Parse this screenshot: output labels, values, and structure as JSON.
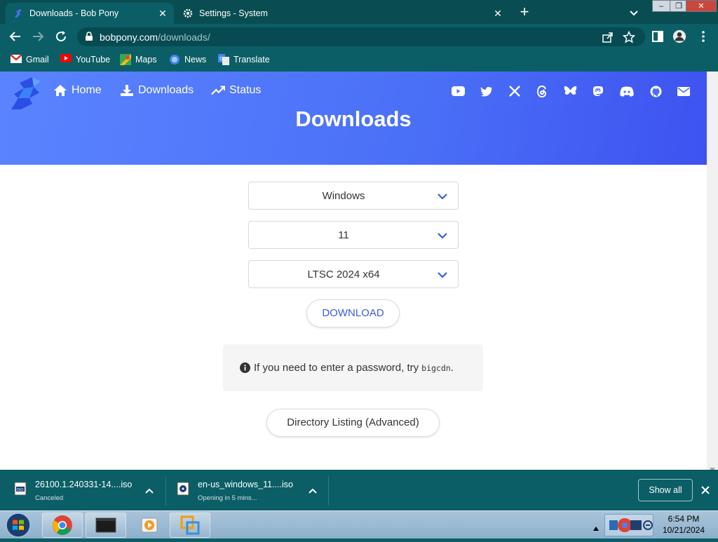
{
  "browser": {
    "tabs": [
      {
        "title": "Downloads - Bob Pony",
        "active": true
      },
      {
        "title": "Settings - System",
        "active": false
      }
    ],
    "url": {
      "host": "bobpony.com",
      "path": "/downloads/"
    },
    "bookmarks": [
      "Gmail",
      "YouTube",
      "Maps",
      "News",
      "Translate"
    ]
  },
  "site": {
    "nav": [
      {
        "label": "Home",
        "icon": "home-icon"
      },
      {
        "label": "Downloads",
        "icon": "download-icon"
      },
      {
        "label": "Status",
        "icon": "trend-icon"
      }
    ],
    "social_icons": [
      "youtube-icon",
      "twitter-icon",
      "x-icon",
      "threads-icon",
      "bluesky-icon",
      "mastodon-icon",
      "discord-icon",
      "github-icon",
      "mail-icon"
    ],
    "title": "Downloads",
    "accent_color": "#4a6ff7"
  },
  "form": {
    "os": "Windows",
    "version": "11",
    "edition": "LTSC 2024 x64",
    "download_label": "DOWNLOAD",
    "note_text": "If you need to enter a password, try",
    "note_code": "bigcdn",
    "note_end": ".",
    "directory_label": "Directory Listing (Advanced)"
  },
  "downloads_shelf": {
    "items": [
      {
        "name": "26100.1.240331-14....iso",
        "status": "Canceled"
      },
      {
        "name": "en-us_windows_11....iso",
        "status": "Opening in 5 mins..."
      }
    ],
    "show_all_label": "Show all"
  },
  "taskbar": {
    "time": "6:54 PM",
    "date": "10/21/2024"
  }
}
